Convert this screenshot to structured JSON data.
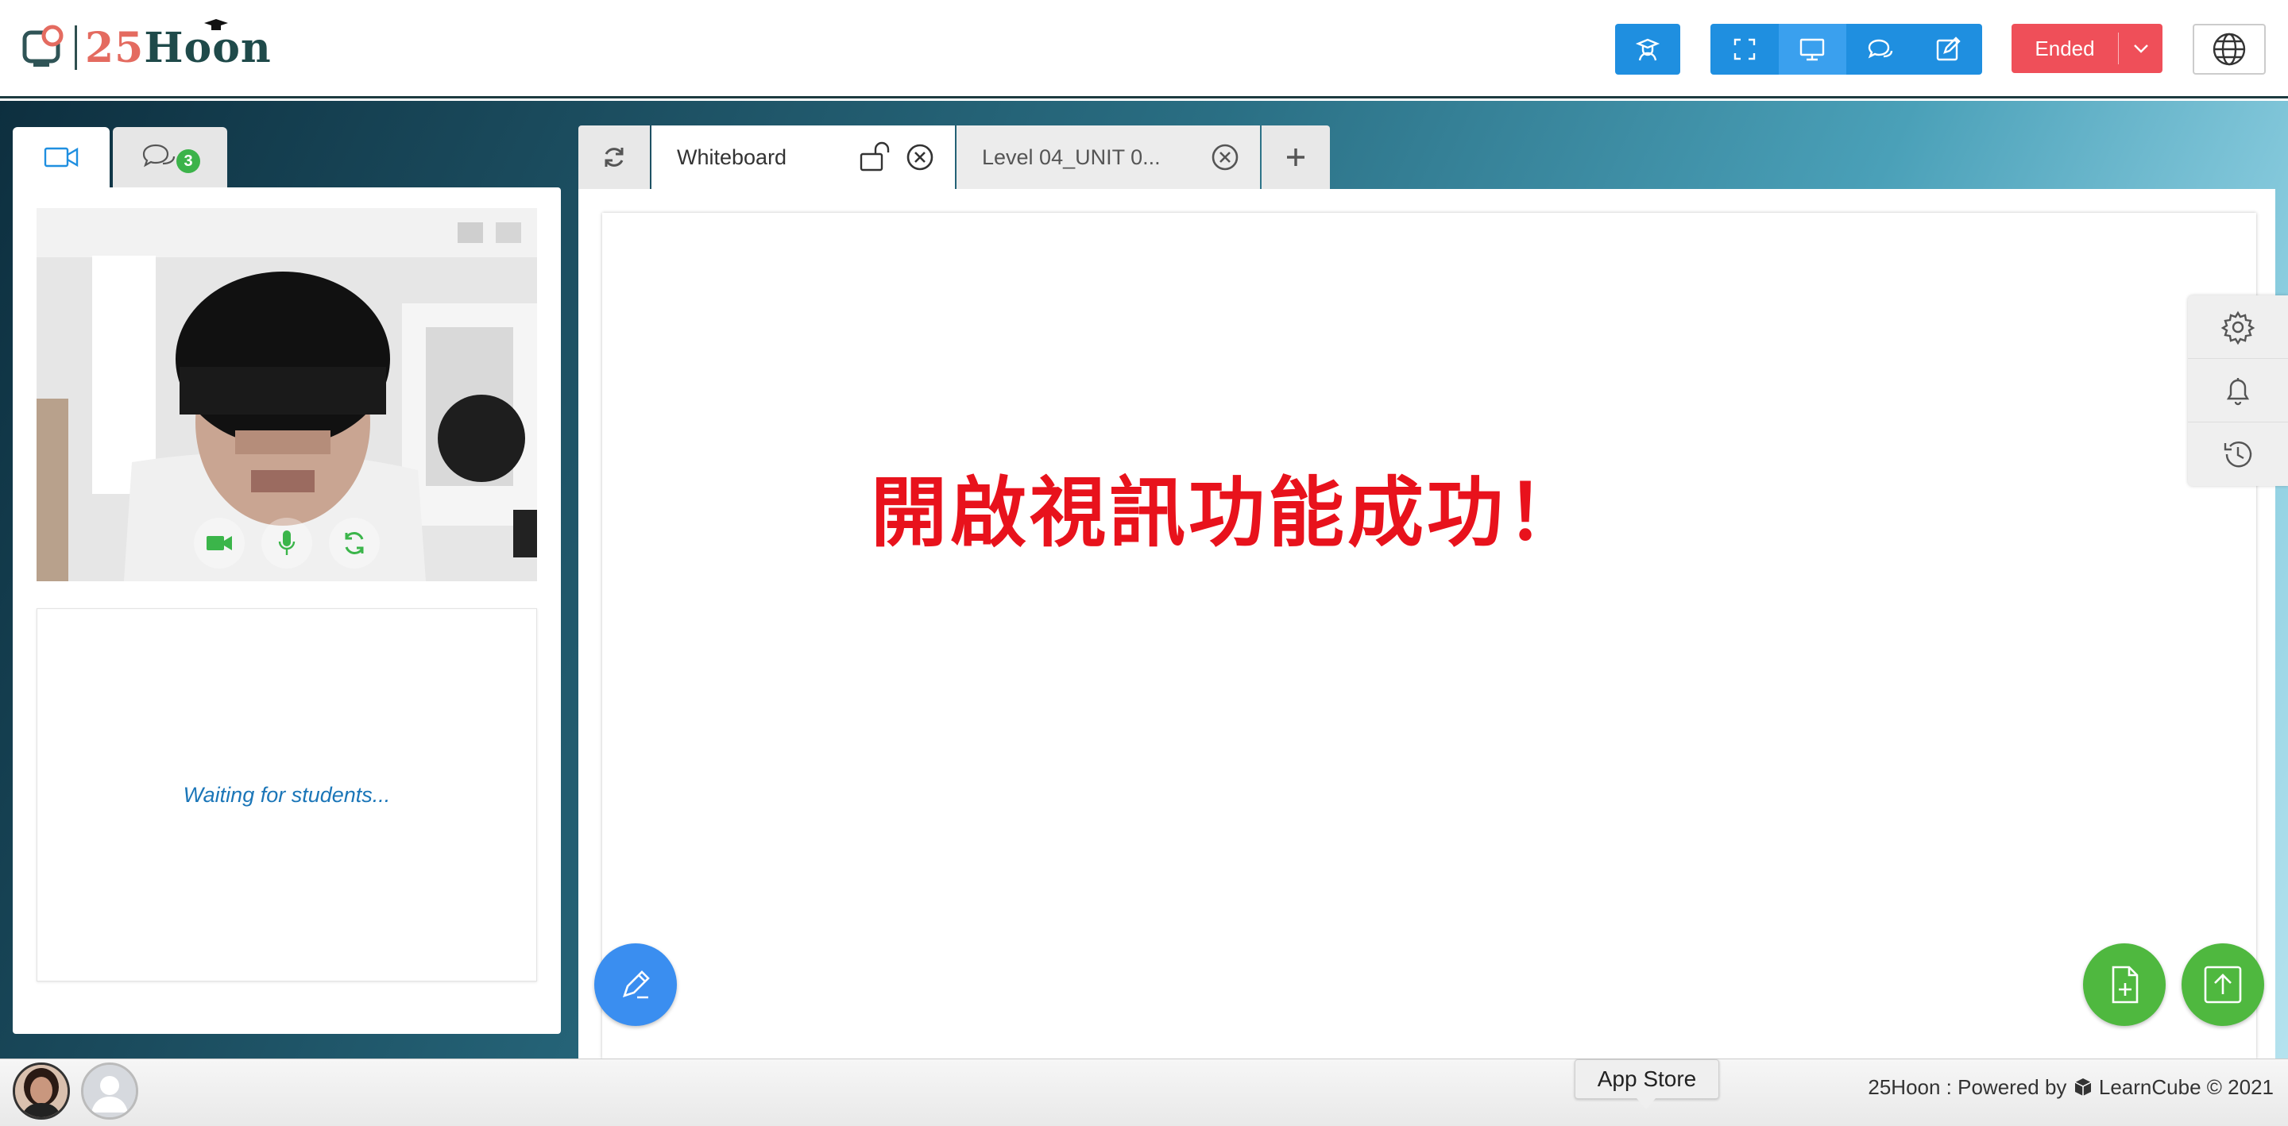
{
  "header": {
    "logo_number": "25",
    "logo_word": "Hoon",
    "teacher_icon": "teacher-icon",
    "view_icons": [
      "fullscreen-icon",
      "screen-share-icon",
      "chat-bubbles-icon",
      "edit-icon"
    ],
    "session_button_label": "Ended",
    "language_icon": "globe-icon"
  },
  "left_panel": {
    "tabs": [
      {
        "icon": "video-camera-icon"
      },
      {
        "icon": "chat-icon",
        "badge": "3"
      }
    ],
    "video_controls": [
      "camera-icon",
      "microphone-icon",
      "switch-camera-icon"
    ],
    "waiting_text": "Waiting for students..."
  },
  "tabs": [
    {
      "label": "Whiteboard",
      "active": true
    },
    {
      "label": "Level 04_UNIT 0...",
      "active": false
    }
  ],
  "whiteboard": {
    "text": "開啟視訊功能成功！"
  },
  "side_tools": [
    "settings-icon",
    "bell-icon",
    "history-icon"
  ],
  "footer": {
    "app_store_label": "App Store",
    "copyright_prefix": "25Hoon : Powered by",
    "copyright_brand": "LearnCube © 2021"
  },
  "colors": {
    "primary_blue": "#1f8fe0",
    "ended_red": "#ef4f59",
    "fab_green": "#4fb83f",
    "fab_blue": "#3a8ef0",
    "whiteboard_text_red": "#e8121c"
  }
}
